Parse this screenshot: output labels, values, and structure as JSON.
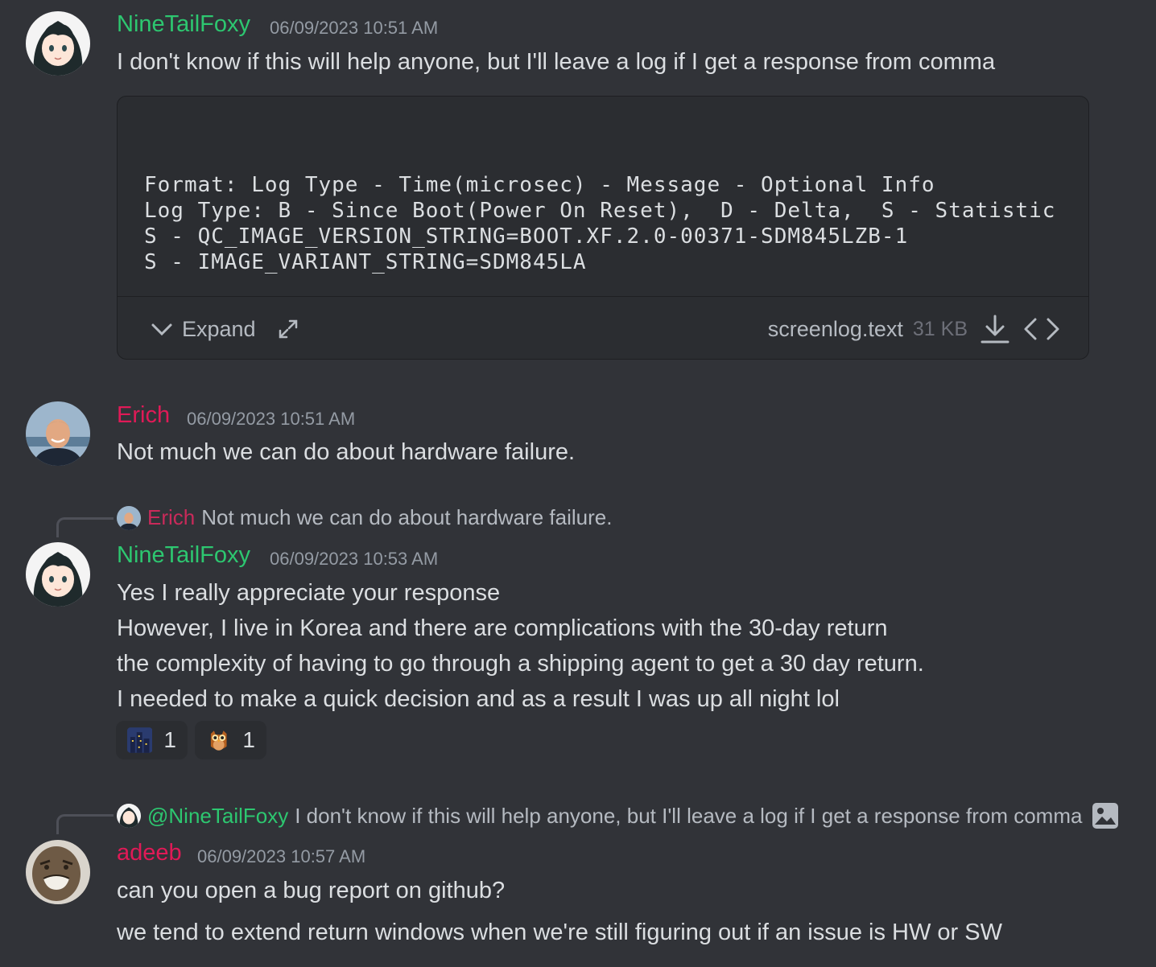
{
  "messages": [
    {
      "author": "NineTailFoxy",
      "timestamp": "06/09/2023 10:51 AM",
      "lines": [
        "I don't know if this will help anyone, but I'll leave a log if I get a response from comma"
      ],
      "attachment": {
        "content": "Format: Log Type - Time(microsec) - Message - Optional Info\nLog Type: B - Since Boot(Power On Reset),  D - Delta,  S - Statistic\nS - QC_IMAGE_VERSION_STRING=BOOT.XF.2.0-00371-SDM845LZB-1\nS - IMAGE_VARIANT_STRING=SDM845LA",
        "expand_label": "Expand",
        "filename": "screenlog.text",
        "filesize": "31 KB"
      }
    },
    {
      "author": "Erich",
      "timestamp": "06/09/2023 10:51 AM",
      "lines": [
        "Not much we can do about hardware failure."
      ]
    },
    {
      "reply_to": {
        "author": "Erich",
        "text": "Not much we can do about hardware failure."
      },
      "author": "NineTailFoxy",
      "timestamp": "06/09/2023 10:53 AM",
      "lines": [
        "Yes I really appreciate your response",
        "However, I live in Korea and there are complications with the 30-day return",
        "the complexity of having to go through a shipping agent to get a 30 day return.",
        "I needed to make a quick decision and as a result I was up all night lol"
      ],
      "reactions": [
        {
          "emoji": "night-city-emoji",
          "count": "1"
        },
        {
          "emoji": "owl-emoji",
          "count": "1"
        }
      ]
    },
    {
      "reply_to": {
        "author": "@NineTailFoxy",
        "text": "I don't know if this will help anyone, but I'll leave a log if I get a response from comma",
        "icon": "image-icon"
      },
      "author": "adeeb",
      "timestamp": "06/09/2023 10:57 AM",
      "lines": [
        "can you open a bug report on github?",
        "we tend to extend return windows when we're still figuring out if an issue is HW or SW"
      ]
    }
  ],
  "colors": {
    "background": "#313338",
    "ninetailfoxy": "#2dc770",
    "erich": "#e01a57",
    "adeeb": "#e01a57",
    "text": "#dbdee1",
    "muted": "#949ba4"
  }
}
